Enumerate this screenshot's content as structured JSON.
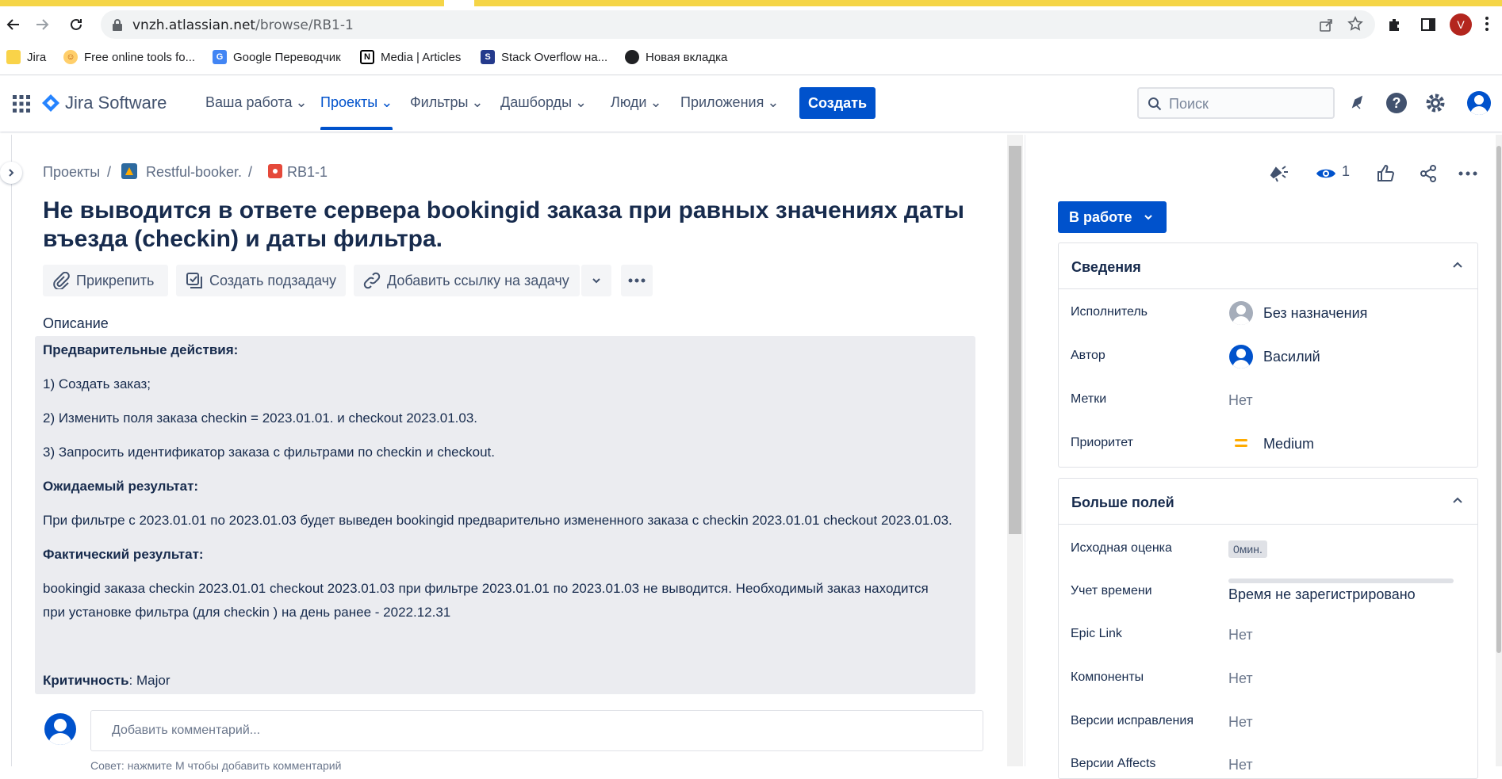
{
  "browser": {
    "url_host": "vnzh.atlassian.net",
    "url_path": "/browse/RB1-1",
    "profile_initial": "V",
    "bookmarks": [
      {
        "label": "Jira",
        "icon": "folder-icon"
      },
      {
        "label": "Free online tools fo...",
        "icon": "smiley-icon"
      },
      {
        "label": "Google Переводчик",
        "icon": "translate-icon"
      },
      {
        "label": "Media | Articles",
        "icon": "notion-icon"
      },
      {
        "label": "Stack Overflow на...",
        "icon": "stackoverflow-icon"
      },
      {
        "label": "Новая вкладка",
        "icon": "globe-icon"
      }
    ]
  },
  "jira": {
    "logo_text": "Jira Software",
    "nav": [
      {
        "label": "Ваша работа"
      },
      {
        "label": "Проекты"
      },
      {
        "label": "Фильтры"
      },
      {
        "label": "Дашборды"
      },
      {
        "label": "Люди"
      },
      {
        "label": "Приложения"
      }
    ],
    "create_label": "Создать",
    "search_placeholder": "Поиск"
  },
  "issue": {
    "breadcrumbs": [
      "Проекты",
      "Restful-booker.",
      "RB1-1"
    ],
    "title": "Не выводится в ответе сервера bookingid заказа при равных значениях даты въезда (checkin) и даты фильтра.",
    "toolbar": {
      "attach": "Прикрепить",
      "subtask": "Создать подзадачу",
      "link": "Добавить ссылку на задачу"
    },
    "description_label": "Описание",
    "description": {
      "pre_heading": "Предварительные действия:",
      "step1": "1) Создать заказ;",
      "step2": " 2) Изменить поля заказа  checkin = 2023.01.01. и  checkout  2023.01.03.",
      "step3": " 3) Запросить идентификатор заказа  с фильтрами по checkin и checkout.",
      "expected_heading": "Ожидаемый  результат:",
      "expected_text": "При фильтре  с 2023.01.01 по 2023.01.03 будет выведен bookingid предварительно измененного заказа  с checkin  2023.01.01 checkout 2023.01.03.",
      "actual_heading": "Фактический результат:",
      "actual_text_1": "bookingid заказа    checkin  2023.01.01 checkout 2023.01.03 при  фильтре  2023.01.01 по 2023.01.03 не  выводится.  Необходимый заказ находится",
      "actual_text_2": "при  установке  фильтра (для checkin  )  на день ранее - 2022.12.31",
      "criticality_label": "Критичность",
      "criticality_value": ": Major"
    },
    "comment_placeholder": "Добавить комментарий...",
    "comment_hint": "Совет: нажмите  M  чтобы добавить комментарий"
  },
  "sidebar": {
    "watchers": "1",
    "status": "В работе",
    "details": {
      "title": "Сведения",
      "fields": [
        {
          "label": "Исполнитель",
          "value": "Без назначения"
        },
        {
          "label": "Автор",
          "value": "Василий"
        },
        {
          "label": "Метки",
          "value": "Нет"
        },
        {
          "label": "Приоритет",
          "value": "Medium"
        }
      ]
    },
    "more": {
      "title": "Больше полей",
      "fields": [
        {
          "label": "Исходная оценка",
          "value": "0мин."
        },
        {
          "label": "Учет времени",
          "value": "Время не зарегистрировано"
        },
        {
          "label": "Epic Link",
          "value": "Нет"
        },
        {
          "label": "Компоненты",
          "value": "Нет"
        },
        {
          "label": "Версии исправления",
          "value": "Нет"
        },
        {
          "label": "Версии Affects",
          "value": "Нет"
        }
      ]
    },
    "colors": {
      "brand": "#0052cc",
      "priority": "#ffab00"
    }
  }
}
